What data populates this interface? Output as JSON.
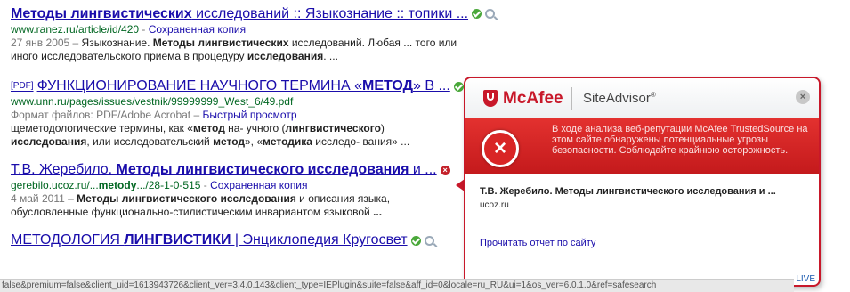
{
  "results": [
    {
      "title_pre": "",
      "title_bold": "Методы лингвистических",
      "title_post": " исследований :: Языкознание :: топики ...",
      "url": "www.ranez.ru/article/id/420",
      "cache": "Сохраненная копия",
      "date": "27 янв 2005 –",
      "snippet1_a": " Языкознание. ",
      "snippet1_b": "Методы лингвистических",
      "snippet1_c": " исследований. Любая ... того или",
      "snippet2_a": "иного исследовательского приема в процедуру ",
      "snippet2_b": "исследования",
      "snippet2_c": ". ..."
    },
    {
      "pdf": "[PDF]",
      "title_pre": "ФУНКЦИОНИРОВАНИЕ НАУЧНОГО ТЕРМИНА «",
      "title_bold": "МЕТОД",
      "title_post": "» В ...",
      "url": "www.unn.ru/pages/issues/vestnik/99999999_West_6/49.pdf",
      "format_label": "Формат файлов: PDF/Adobe Acrobat –",
      "quick_view": "Быстрый просмотр",
      "snippet1_a": "щеметодологические термины, как «",
      "snippet1_b": "метод",
      "snippet1_c": " на- учного (",
      "snippet1_d": "лингвистического",
      "snippet1_e": ")",
      "snippet2_a": "исследования",
      "snippet2_b": ", или исследовательский ",
      "snippet2_c": "метод",
      "snippet2_d": "», «",
      "snippet2_e": "методика",
      "snippet2_f": " исследо- вания» ..."
    },
    {
      "title_pre": "Т.В. Жеребило. ",
      "title_bold": "Методы лингвистического исследования",
      "title_post": " и ...",
      "url_a": "gerebilo.ucoz.ru/...",
      "url_b": "metody",
      "url_c": ".../28-1-0-515",
      "cache": "Сохраненная копия",
      "date": "4 май 2011 –",
      "snippet1_a": " ",
      "snippet1_b": "Методы лингвистического исследования",
      "snippet1_c": " и описания языка,",
      "snippet2_a": "обусловленные функционально-стилистическим инвариантом языковой ",
      "snippet2_b": "..."
    },
    {
      "title_pre": "МЕТОДОЛОГИЯ ",
      "title_bold": "ЛИНГВИСТИКИ",
      "title_post": " | Энциклопедия Кругосвет"
    }
  ],
  "popup": {
    "brand": "McAfee",
    "product": "SiteAdvisor",
    "product_mark": "®",
    "close": "×",
    "warning": "В ходе анализа веб-репутации McAfee TrustedSource на этом сайте обнаружены потенциальные угрозы безопасности. Соблюдайте крайнюю осторожность.",
    "site_title": "Т.В. Жеребило. Методы лингвистического исследования и ...",
    "domain": "ucoz.ru",
    "report_link": "Прочитать отчет по сайту",
    "footer_live": "LIVE"
  },
  "statusbar": "false&premium=false&client_uid=1613943726&client_ver=3.4.0.143&client_type=IEPlugin&suite=false&aff_id=0&locale=ru_RU&ui=1&os_ver=6.0.1.0&ref=safesearch",
  "colors": {
    "link": "#1a0dab",
    "url": "#006621",
    "mcafee_red": "#c8182a",
    "safe_green": "#4aa83a"
  },
  "icons": [
    "check-safe-icon",
    "magnifier-icon",
    "danger-x-icon",
    "mcafee-shield-icon",
    "close-icon"
  ]
}
